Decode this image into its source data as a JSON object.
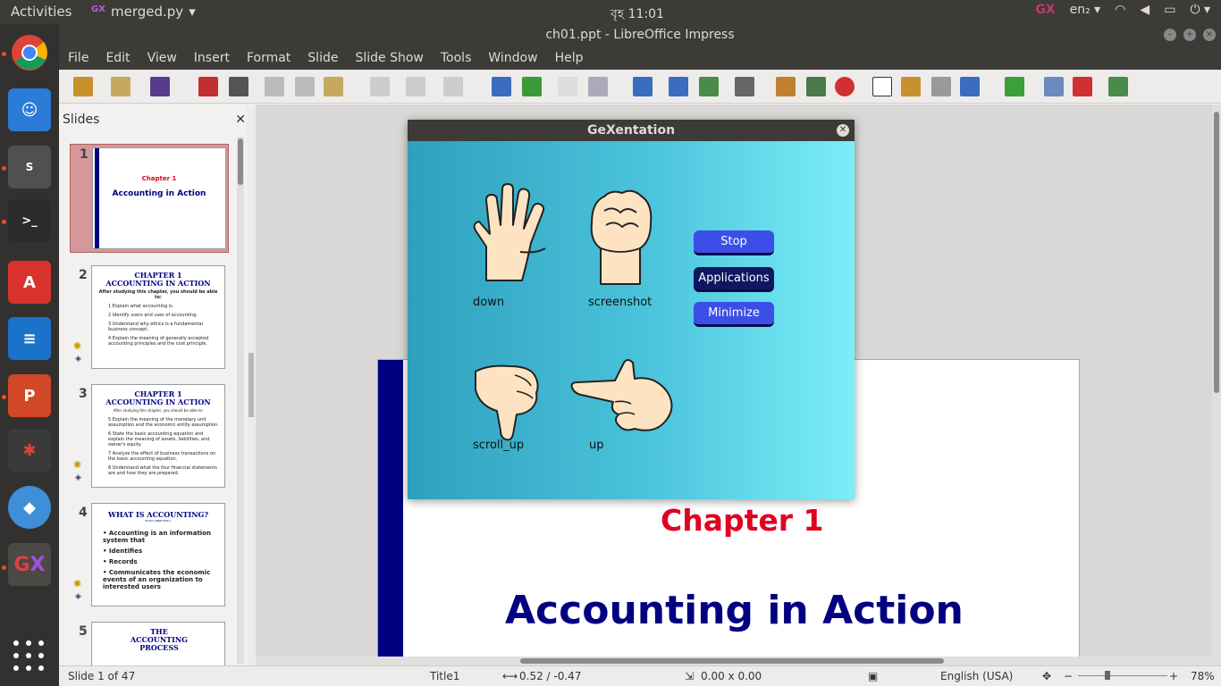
{
  "topbar": {
    "activities": "Activities",
    "app_name": "merged.py",
    "clock": "বৃহ 11:01",
    "language": "en₂"
  },
  "window": {
    "title": "ch01.ppt - LibreOffice Impress"
  },
  "menu": [
    "File",
    "Edit",
    "View",
    "Insert",
    "Format",
    "Slide",
    "Slide Show",
    "Tools",
    "Window",
    "Help"
  ],
  "slides_pane": {
    "title": "Slides",
    "thumbnails": [
      {
        "num": "1",
        "title": "Chapter 1",
        "subtitle": "Accounting in Action"
      },
      {
        "num": "2",
        "title": "CHAPTER 1",
        "title2": "ACCOUNTING IN ACTION",
        "intro": "After studying this chapter, you should be able to:",
        "bullets": [
          "1 Explain what accounting is.",
          "2 Identify users and uses of accounting.",
          "3 Understand why ethics is a fundamental business concept.",
          "4 Explain the meaning of generally accepted accounting principles and the cost principle."
        ]
      },
      {
        "num": "3",
        "title": "CHAPTER 1",
        "title2": "ACCOUNTING IN ACTION",
        "intro": "After studying this chapter, you should be able to:",
        "bullets": [
          "5 Explain the meaning of the monetary unit assumption and the economic entity assumption.",
          "6 State the basic accounting equation and explain the meaning of assets, liabilities, and owner's equity.",
          "7 Analyze the effect of business transactions on the basic accounting equation.",
          "8 Understand what the four financial statements are and how they are prepared."
        ]
      },
      {
        "num": "4",
        "title": "WHAT IS ACCOUNTING?",
        "subtitle": "STUDY OBJECTIVE 1",
        "bullets": [
          "Accounting is an information system that",
          "Identifies",
          "Records",
          "Communicates the economic events of an organization to interested users"
        ]
      },
      {
        "num": "5",
        "title": "THE ACCOUNTING PROCESS"
      }
    ]
  },
  "slide": {
    "chapter": "Chapter 1",
    "title": "Accounting in Action"
  },
  "statusbar": {
    "slide_info": "Slide 1 of 47",
    "layout": "Title1",
    "position": "0.52 / -0.47",
    "size": "0.00 x 0.00",
    "language": "English (USA)",
    "zoom": "78%"
  },
  "dialog": {
    "title": "GeXentation",
    "gestures": [
      {
        "icon": "open-palm-hand-icon",
        "label": "down"
      },
      {
        "icon": "fist-hand-icon",
        "label": "screenshot"
      },
      {
        "icon": "thumbs-down-hand-icon",
        "label": "scroll_up"
      },
      {
        "icon": "pointing-left-hand-icon",
        "label": "up"
      }
    ],
    "buttons": {
      "stop": "Stop",
      "applications": "Applications",
      "minimize": "Minimize"
    }
  },
  "colors": {
    "slide_title_blue": "#000080",
    "chapter_red": "#e00020",
    "dialog_button_blue": "#3b4fe8",
    "dialog_button_navy": "#0f1760"
  }
}
